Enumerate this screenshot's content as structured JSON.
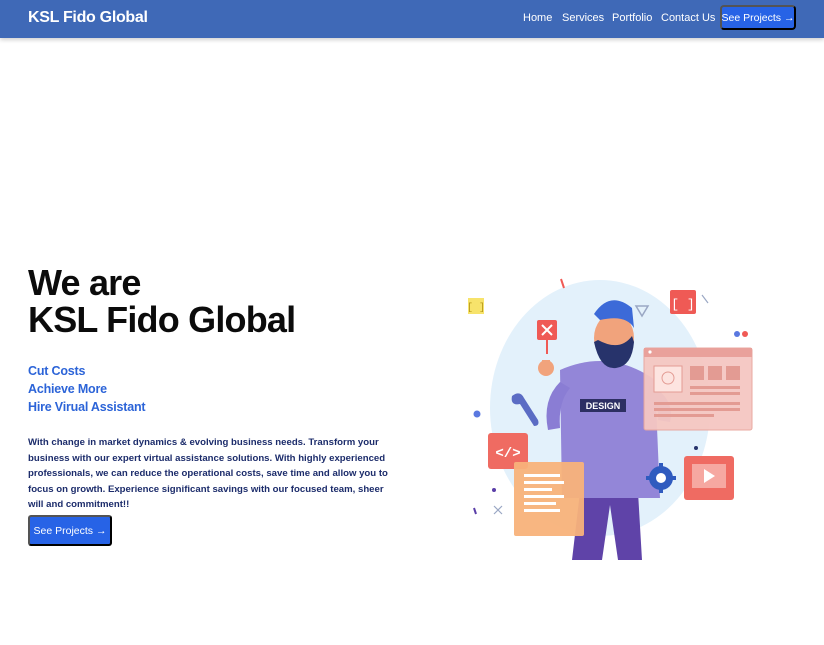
{
  "navbar": {
    "brand": "KSL Fido Global",
    "links": [
      "Home",
      "Services",
      "Portfolio",
      "Contact Us"
    ],
    "cta_label": "See Projects →"
  },
  "hero": {
    "title_line1": "We are",
    "title_line2": "KSL Fido Global",
    "taglines": [
      "Cut Costs",
      "Achieve More",
      "Hire Virual Assistant"
    ],
    "description": "With change in market dynamics & evolving business needs. Transform your business with our expert virtual assistance solutions. With highly experienced professionals, we can reduce the operational costs, save time and allow you to focus on growth. Experience significant savings with our focused team, sheer will and commitment!!",
    "cta_label": "See Projects →"
  },
  "illustration": {
    "shirt_text": "DESIGN",
    "icons": [
      "code-icon",
      "video-play-icon",
      "gear-icon",
      "close-icon",
      "brackets-icon",
      "wrench-icon"
    ]
  },
  "colors": {
    "navbar": "#3f69b7",
    "button": "#2763e6",
    "tagline": "#2c64d8",
    "description": "#1c2c6b"
  }
}
